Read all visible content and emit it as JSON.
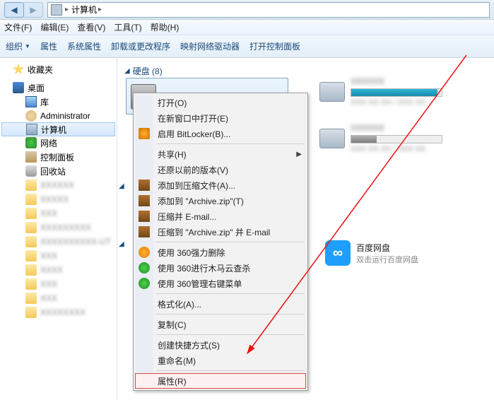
{
  "titlebar": {
    "path_label": "计算机",
    "chev": "▸"
  },
  "menubar": {
    "file": "文件(F)",
    "edit": "编辑(E)",
    "view": "查看(V)",
    "tools": "工具(T)",
    "help": "帮助(H)"
  },
  "toolbar": {
    "organize": "组织",
    "properties": "属性",
    "sys_properties": "系统属性",
    "uninstall": "卸载或更改程序",
    "map_drive": "映射网络驱动器",
    "control_panel": "打开控制面板"
  },
  "sidebar": {
    "favorites": "收藏夹",
    "desktop": "桌面",
    "items": [
      {
        "label": "库"
      },
      {
        "label": "Administrator"
      },
      {
        "label": "计算机"
      },
      {
        "label": "网络"
      },
      {
        "label": "控制面板"
      },
      {
        "label": "回收站"
      }
    ]
  },
  "content": {
    "section_drives": "硬盘 (8)"
  },
  "baidu": {
    "title": "百度网盘",
    "subtitle": "双击运行百度网盘"
  },
  "context_menu": {
    "open": "打开(O)",
    "open_new_window": "在新窗口中打开(E)",
    "enable_bitlocker": "启用 BitLocker(B)...",
    "share": "共享(H)",
    "restore_versions": "还原以前的版本(V)",
    "add_to_archive": "添加到压缩文件(A)...",
    "add_to_zip": "添加到 \"Archive.zip\"(T)",
    "compress_email": "压缩并 E-mail...",
    "compress_zip_email": "压缩到 \"Archive.zip\" 并 E-mail",
    "use_360_force_delete": "使用 360强力删除",
    "use_360_trojan_scan": "使用 360进行木马云查杀",
    "use_360_rightclick": "使用 360管理右键菜单",
    "format": "格式化(A)...",
    "copy": "复制(C)",
    "create_shortcut": "创建快捷方式(S)",
    "rename": "重命名(M)",
    "properties": "属性(R)"
  }
}
